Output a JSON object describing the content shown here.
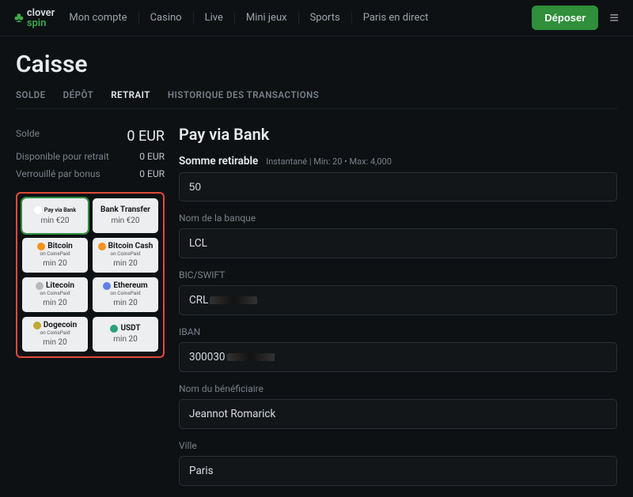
{
  "brand": {
    "name_a": "clover",
    "name_b": "spin"
  },
  "nav": {
    "items": [
      "Mon compte",
      "Casino",
      "Live",
      "Mini jeux",
      "Sports",
      "Paris en direct"
    ],
    "deposit": "Déposer"
  },
  "page_title": "Caisse",
  "tabs": {
    "items": [
      "SOLDE",
      "DÉPÔT",
      "RETRAIT",
      "HISTORIQUE DES TRANSACTIONS"
    ],
    "active_index": 2
  },
  "balance": {
    "rows": [
      {
        "label": "Solde",
        "value": "0 EUR",
        "big": true
      },
      {
        "label": "Disponible pour retrait",
        "value": "0 EUR",
        "big": false
      },
      {
        "label": "Verrouillé par bonus",
        "value": "0 EUR",
        "big": false
      }
    ]
  },
  "methods": [
    {
      "name": "Pay via Bank",
      "sub": "",
      "min": "min €20",
      "icon_bg": "#fff",
      "selected": true,
      "small": true
    },
    {
      "name": "Bank Transfer",
      "sub": "",
      "min": "min €20",
      "icon_bg": "",
      "selected": false
    },
    {
      "name": "Bitcoin",
      "sub": "on CoinsPaid",
      "min": "min 20",
      "icon_bg": "#f7931a",
      "selected": false
    },
    {
      "name": "Bitcoin Cash",
      "sub": "on CoinsPaid",
      "min": "min 20",
      "icon_bg": "#f7931a",
      "selected": false,
      "prefix": "BO"
    },
    {
      "name": "Litecoin",
      "sub": "on CoinsPaid",
      "min": "min 20",
      "icon_bg": "#b8b8b8",
      "selected": false
    },
    {
      "name": "Ethereum",
      "sub": "on CoinsPaid",
      "min": "min 20",
      "icon_bg": "#627eea",
      "selected": false
    },
    {
      "name": "Dogecoin",
      "sub": "on CoinsPaid",
      "min": "min 20",
      "icon_bg": "#c2a633",
      "selected": false
    },
    {
      "name": "USDT",
      "sub": "",
      "min": "min 20",
      "icon_bg": "#26a17b",
      "selected": false
    }
  ],
  "form": {
    "title": "Pay via Bank",
    "amount_label": "Somme retirable",
    "amount_hint": "Instantané | Min: 20 • Max: 4,000",
    "amount_value": "50",
    "fields": [
      {
        "label": "Nom de la banque",
        "value": "LCL",
        "redacted": false
      },
      {
        "label": "BIC/SWIFT",
        "value": "CRL",
        "redacted": true
      },
      {
        "label": "IBAN",
        "value": "300030",
        "redacted": true
      },
      {
        "label": "Nom du bénéficiaire",
        "value": "Jeannot Romarick",
        "redacted": false
      },
      {
        "label": "Ville",
        "value": "Paris",
        "redacted": false
      }
    ]
  }
}
